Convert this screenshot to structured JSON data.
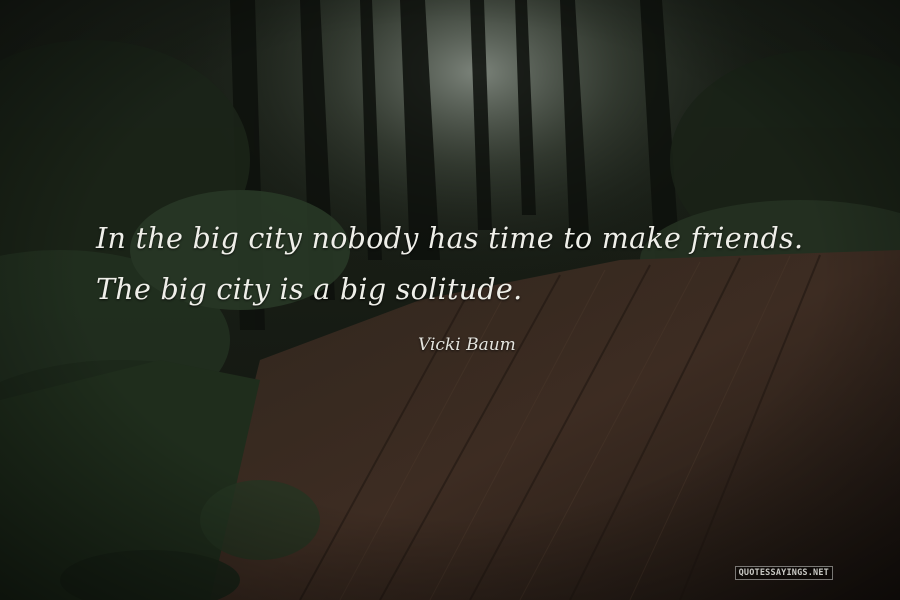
{
  "quote": {
    "lines": [
      "In the big city nobody has time to make friends.",
      "The big city is a big solitude."
    ],
    "author": "Vicki Baum"
  },
  "watermark": {
    "text": "QUOTESSAYINGS.NET"
  },
  "colors": {
    "text": "#efefe9",
    "background_forest": "#141a12",
    "log_wood": "#3a2a20"
  },
  "background": {
    "description_icon": "forest-log-photo"
  }
}
